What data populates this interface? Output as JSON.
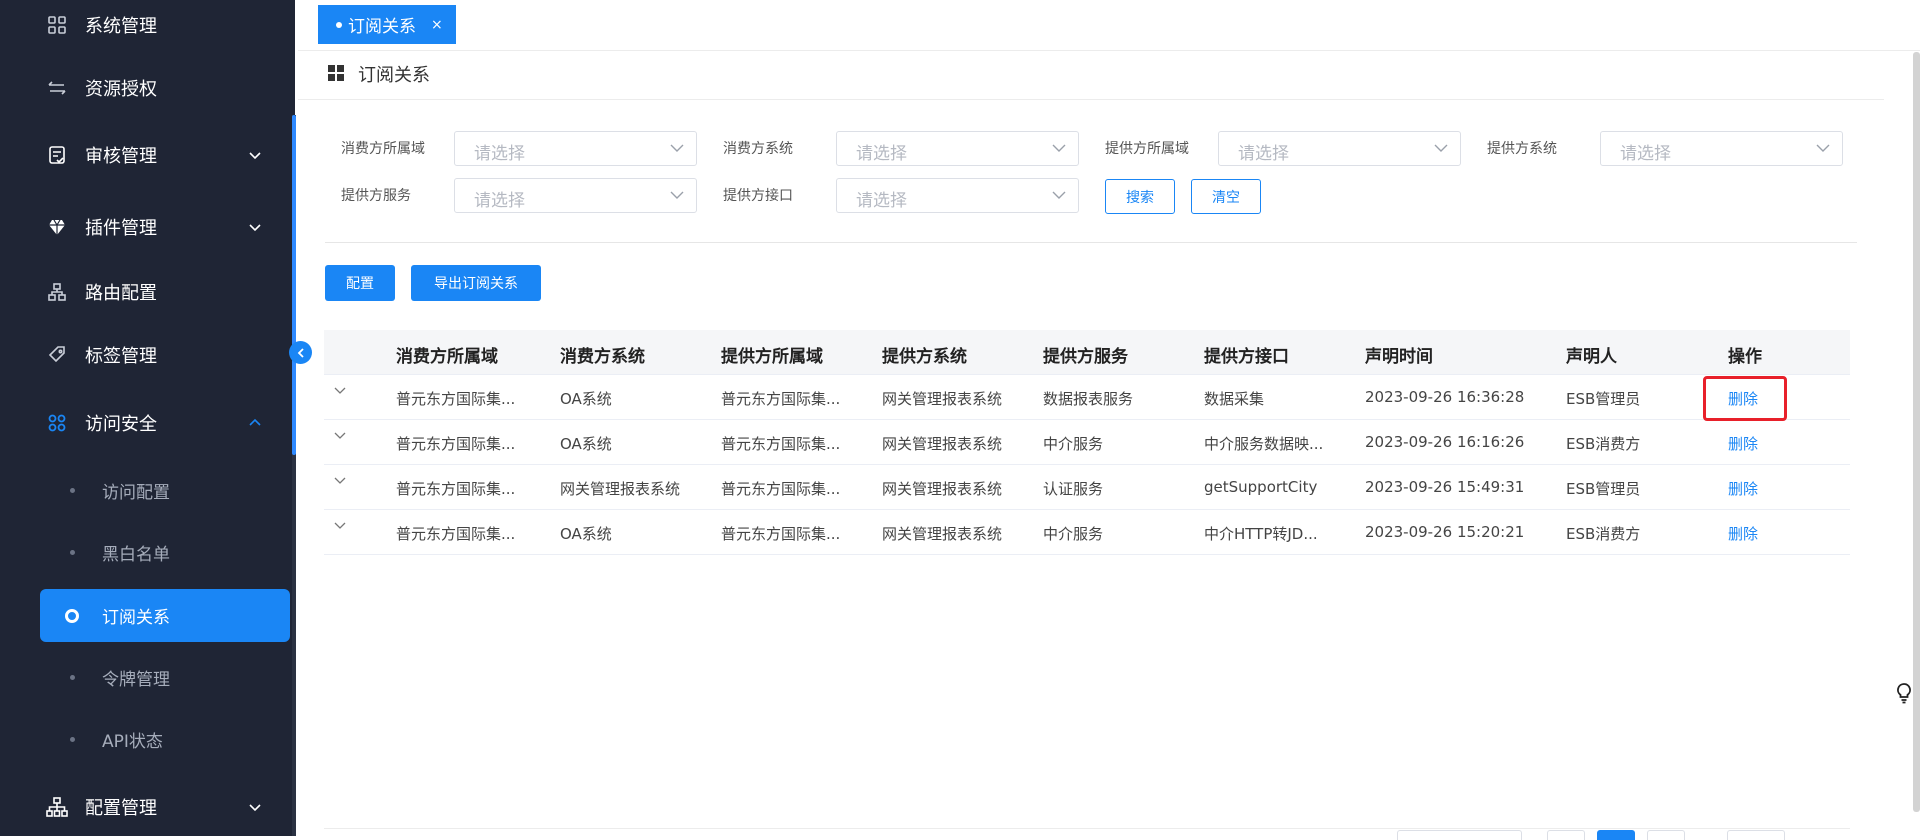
{
  "sidebar": {
    "items": [
      {
        "label": "系统管理",
        "icon": "grid-icon"
      },
      {
        "label": "资源授权",
        "icon": "transfer-icon"
      },
      {
        "label": "审核管理",
        "icon": "audit-icon"
      },
      {
        "label": "插件管理",
        "icon": "diamond-icon"
      },
      {
        "label": "路由配置",
        "icon": "network-icon"
      },
      {
        "label": "标签管理",
        "icon": "tag-icon"
      },
      {
        "label": "访问安全",
        "icon": "apps-icon"
      },
      {
        "label": "配置管理",
        "icon": "sitemap-icon"
      }
    ],
    "sub_items": [
      {
        "label": "访问配置"
      },
      {
        "label": "黑白名单"
      },
      {
        "label": "订阅关系"
      },
      {
        "label": "令牌管理"
      },
      {
        "label": "API状态"
      }
    ]
  },
  "tabs": [
    {
      "label": "订阅关系",
      "close": "×"
    }
  ],
  "page": {
    "title": "订阅关系"
  },
  "filters": {
    "consumer_domain_label": "消费方所属域",
    "consumer_system_label": "消费方系统",
    "provider_domain_label": "提供方所属域",
    "provider_system_label": "提供方系统",
    "provider_service_label": "提供方服务",
    "provider_interface_label": "提供方接口",
    "placeholder": "请选择",
    "search_label": "搜索",
    "clear_label": "清空"
  },
  "toolbar": {
    "config_label": "配置",
    "export_label": "导出订阅关系"
  },
  "table": {
    "headers": [
      "消费方所属域",
      "消费方系统",
      "提供方所属域",
      "提供方系统",
      "提供方服务",
      "提供方接口",
      "声明时间",
      "声明人",
      "操作"
    ],
    "rows": [
      [
        "普元东方国际集...",
        "OA系统",
        "普元东方国际集...",
        "网关管理报表系统",
        "数据报表服务",
        "数据采集",
        "2023-09-26 16:36:28",
        "ESB管理员",
        "删除"
      ],
      [
        "普元东方国际集...",
        "OA系统",
        "普元东方国际集...",
        "网关管理报表系统",
        "中介服务",
        "中介服务数据映...",
        "2023-09-26 16:16:26",
        "ESB消费方",
        "删除"
      ],
      [
        "普元东方国际集...",
        "网关管理报表系统",
        "普元东方国际集...",
        "网关管理报表系统",
        "认证服务",
        "getSupportCity",
        "2023-09-26 15:49:31",
        "ESB管理员",
        "删除"
      ],
      [
        "普元东方国际集...",
        "OA系统",
        "普元东方国际集...",
        "网关管理报表系统",
        "中介服务",
        "中介HTTP转JD...",
        "2023-09-26 15:20:21",
        "ESB消费方",
        "删除"
      ]
    ]
  },
  "colors": {
    "accent": "#1a86f5",
    "sidebar_bg": "#1f2535",
    "highlight": "#e8202a"
  }
}
